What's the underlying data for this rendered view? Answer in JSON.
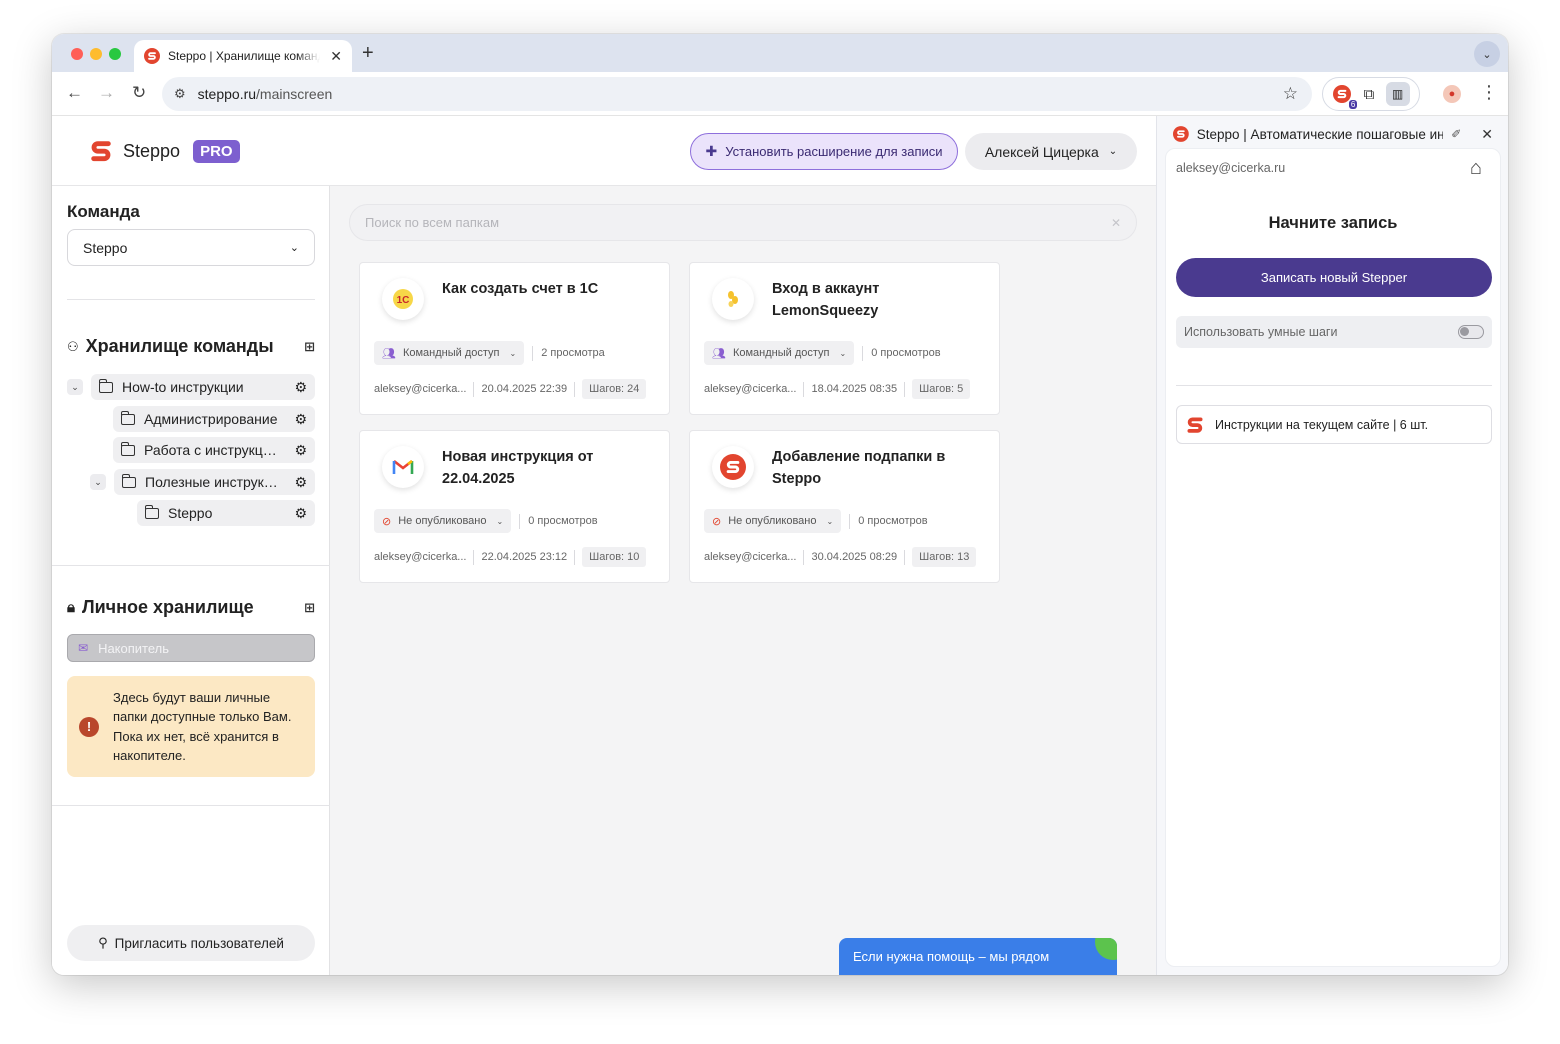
{
  "browser": {
    "tab_title": "Steppo | Хранилище команд",
    "tab_close": "✕",
    "new_tab": "+",
    "url_host": "steppo.ru",
    "url_path": "/mainscreen",
    "ext_badge": "6"
  },
  "header": {
    "brand": "Steppo",
    "pro": "PRO",
    "install_label": "Установить расширение для записи",
    "user_name": "Алексей Цицерка"
  },
  "sidebar": {
    "team_title": "Команда",
    "team_selected": "Steppo",
    "team_storage_title": "Хранилище команды",
    "tree": [
      {
        "label": "How-to инструкции"
      },
      {
        "label": "Администрирование"
      },
      {
        "label": "Работа с инструкциями"
      },
      {
        "label": "Полезные инструкции"
      },
      {
        "label": "Steppo"
      }
    ],
    "personal_title": "Личное хранилище",
    "inbox_label": "Накопитель",
    "notice": "Здесь будут ваши личные папки доступные только Вам. Пока их нет, всё хранится в накопителе.",
    "invite_label": "Пригласить пользователей"
  },
  "main": {
    "search_placeholder": "Поиск по всем папкам",
    "cards": [
      {
        "title": "Как создать счет в 1С",
        "access": "Командный доступ",
        "views": "2 просмотра",
        "author": "aleksey@cicerka...",
        "date": "20.04.2025 22:39",
        "steps": "Шагов: 24",
        "logo": "1C"
      },
      {
        "title": "Вход в аккаунт LemonSqueezy",
        "access": "Командный доступ",
        "views": "0 просмотров",
        "author": "aleksey@cicerka...",
        "date": "18.04.2025 08:35",
        "steps": "Шагов: 5",
        "logo": "lemon"
      },
      {
        "title": "Новая инструкция от 22.04.2025",
        "access": "Не опубликовано",
        "views": "0 просмотров",
        "author": "aleksey@cicerka...",
        "date": "22.04.2025 23:12",
        "steps": "Шагов: 10",
        "logo": "gmail"
      },
      {
        "title": "Добавление подпапки в Steppo",
        "access": "Не опубликовано",
        "views": "0 просмотров",
        "author": "aleksey@cicerka...",
        "date": "30.04.2025 08:29",
        "steps": "Шагов: 13",
        "logo": "steppo"
      }
    ],
    "help_label": "Если нужна помощь – мы рядом"
  },
  "sidepanel": {
    "title": "Steppo | Автоматические пошаговые инструкции",
    "email": "aleksey@cicerka.ru",
    "heading": "Начните запись",
    "record_label": "Записать новый Stepper",
    "smart_steps_label": "Использовать умные шаги",
    "smart_steps_on": false,
    "site_instructions": "Инструкции на текущем сайте | 6 шт."
  },
  "colors": {
    "brand_red": "#e2452f",
    "accent_purple": "#7d5fcf",
    "record_button": "#4a3a8f",
    "help_blue": "#3a7ee8"
  }
}
